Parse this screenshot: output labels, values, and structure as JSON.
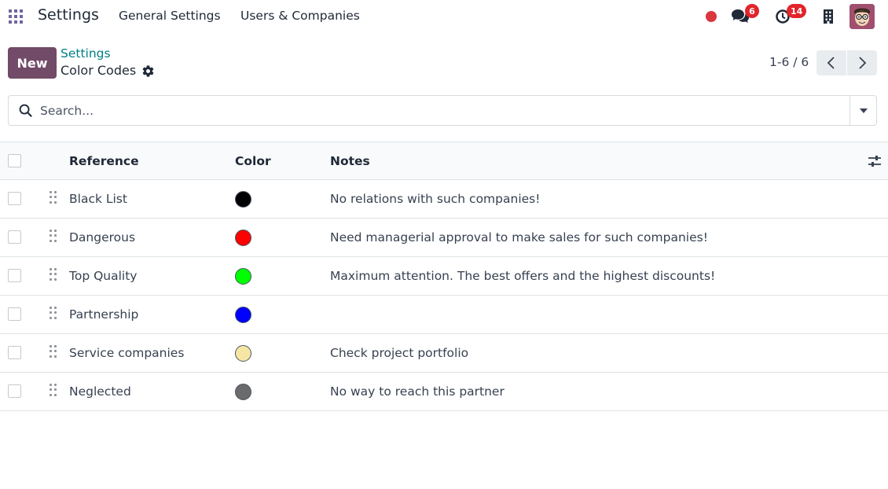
{
  "navbar": {
    "app_name": "Settings",
    "menu": [
      "General Settings",
      "Users & Companies"
    ],
    "messages_badge": "6",
    "activities_badge": "14",
    "status_dot_color": "#d9363e"
  },
  "control_panel": {
    "new_label": "New",
    "breadcrumb": "Settings",
    "title": "Color Codes",
    "pager": "1-6 / 6"
  },
  "search": {
    "placeholder": "Search..."
  },
  "list": {
    "headers": {
      "reference": "Reference",
      "color": "Color",
      "notes": "Notes"
    },
    "rows": [
      {
        "reference": "Black List",
        "color": "#000000",
        "notes": "No relations with such companies!"
      },
      {
        "reference": "Dangerous",
        "color": "#ff0000",
        "notes": "Need managerial approval to make sales for such companies!"
      },
      {
        "reference": "Top Quality",
        "color": "#00ff00",
        "notes": "Maximum attention. The best offers and the highest discounts!"
      },
      {
        "reference": "Partnership",
        "color": "#0000ff",
        "notes": ""
      },
      {
        "reference": "Service companies",
        "color": "#f5e6a3",
        "notes": "Check project portfolio"
      },
      {
        "reference": "Neglected",
        "color": "#6b6b6b",
        "notes": "No way to reach this partner"
      }
    ]
  },
  "icons": {
    "apps": "apps-grid-icon",
    "messages": "chat-bubbles-icon",
    "activities": "clock-icon",
    "company": "building-icon",
    "settings": "gear-icon",
    "search": "search-icon",
    "drag": "drag-handle-icon",
    "optional_columns": "sliders-icon"
  },
  "colors": {
    "brand": "#714b67",
    "link": "#017e84",
    "badge": "#e3242b"
  }
}
